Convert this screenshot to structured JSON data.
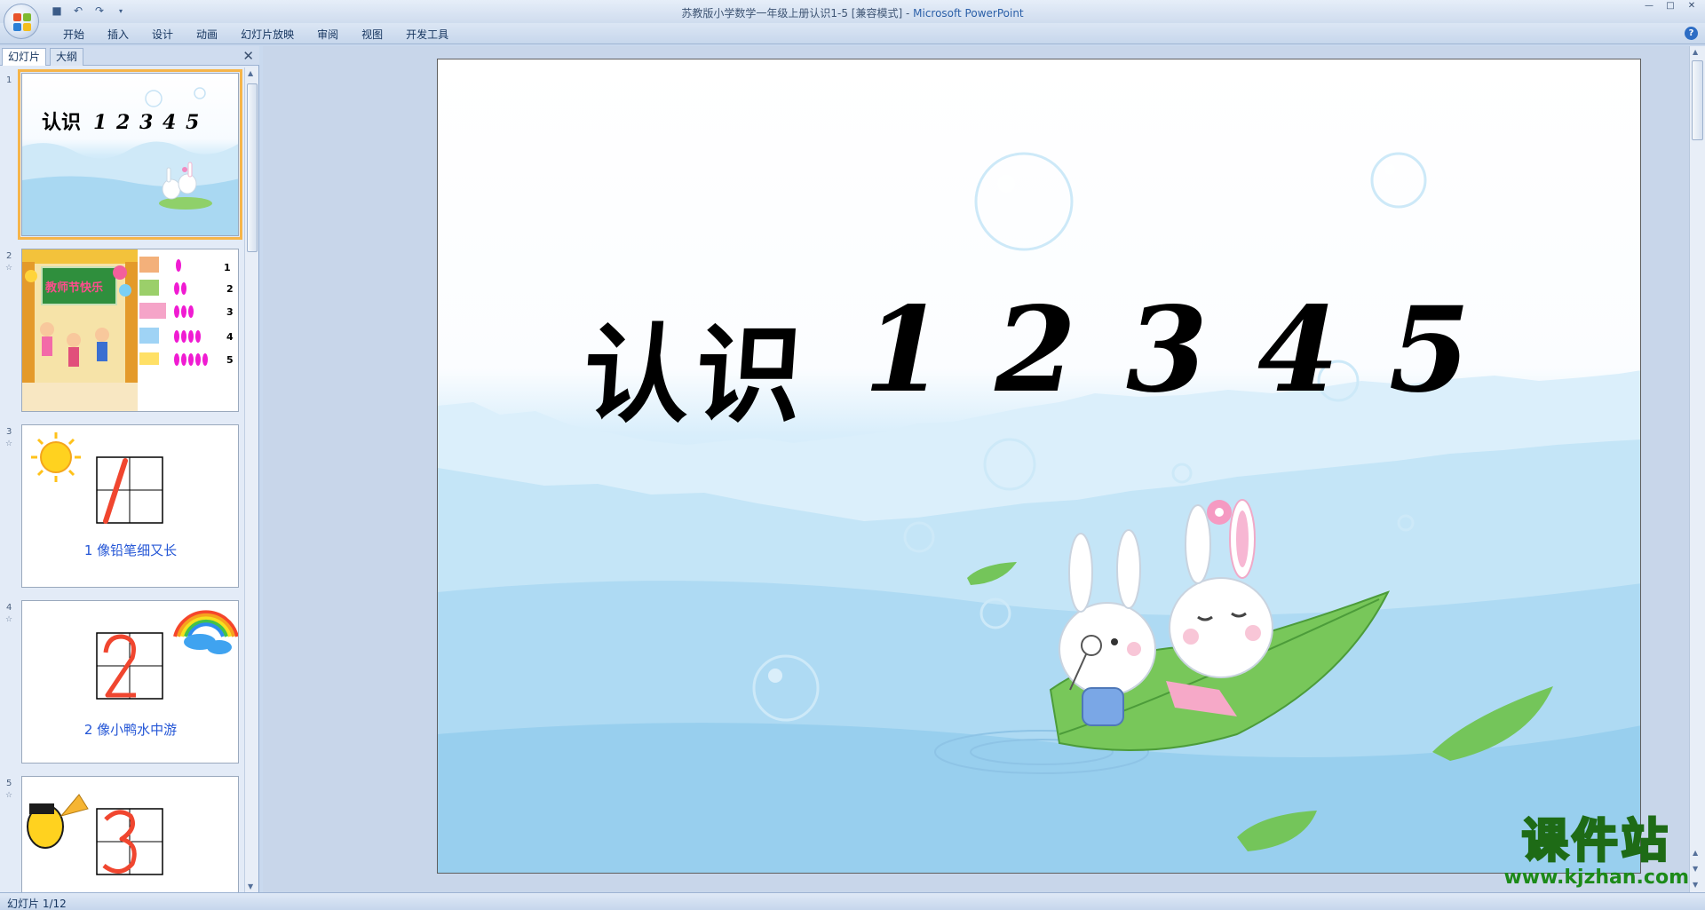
{
  "window": {
    "title_doc": "苏教版小学数学一年级上册认识1-5 [兼容模式] - ",
    "title_app": "Microsoft PowerPoint"
  },
  "ribbon": {
    "tabs": [
      "开始",
      "插入",
      "设计",
      "动画",
      "幻灯片放映",
      "审阅",
      "视图",
      "开发工具"
    ]
  },
  "left_pane": {
    "tabs": [
      "幻灯片",
      "大纲"
    ],
    "slides": [
      {
        "number": "1",
        "title": "认识",
        "digits": [
          "1",
          "2",
          "3",
          "4",
          "5"
        ]
      },
      {
        "number": "2",
        "banner": "教师节快乐",
        "counts": [
          "1",
          "2",
          "3",
          "4",
          "5"
        ]
      },
      {
        "number": "3",
        "caption": "1 像铅笔细又长"
      },
      {
        "number": "4",
        "caption": "2 像小鸭水中游"
      },
      {
        "number": "5"
      }
    ]
  },
  "slide": {
    "title_chinese": "认识",
    "digits": [
      "1",
      "2",
      "3",
      "4",
      "5"
    ]
  },
  "status": {
    "text": "幻灯片 1/12"
  },
  "watermark": {
    "brand": "课件站",
    "url": "www.kjzhan.com"
  },
  "colors": {
    "selection": "#f6b54a",
    "ribbon_bg": "#dbe6f4",
    "accent": "#2b5fa8"
  }
}
